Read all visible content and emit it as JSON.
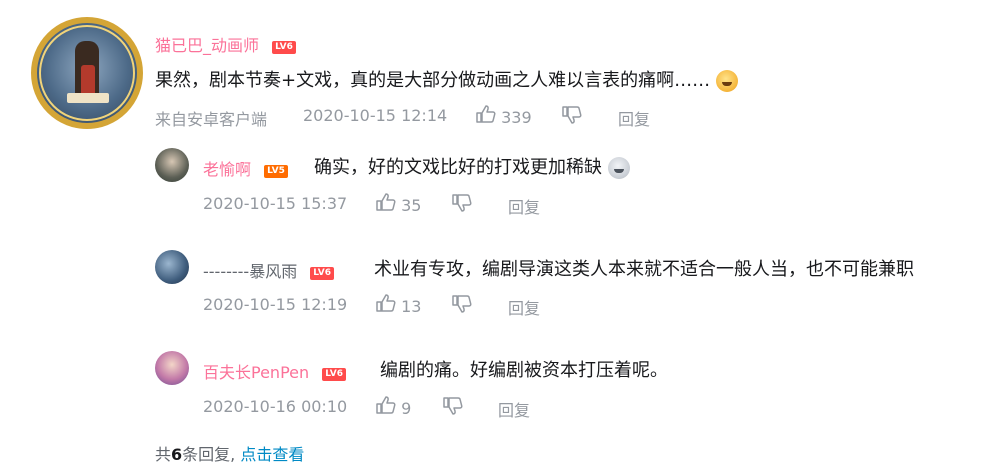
{
  "main_comment": {
    "username": "猫已巴_动画师",
    "level": "LV6",
    "content": "果然，剧本节奏+文戏，真的是大部分做动画之人难以言表的痛啊……",
    "source": "来自安卓客户端",
    "time": "2020-10-15 12:14",
    "likes": "339",
    "reply_label": "回复",
    "emoji": "crying-laugh-emoji"
  },
  "replies": [
    {
      "username": "老愉啊",
      "level": "LV5",
      "content": "确实，好的文戏比好的打戏更加稀缺",
      "time": "2020-10-15 15:37",
      "likes": "35",
      "reply_label": "回复",
      "emoji": "speechless-emoji"
    },
    {
      "username": "--------暴风雨",
      "level": "LV6",
      "content": "术业有专攻，编剧导演这类人本来就不适合一般人当，也不可能兼职",
      "time": "2020-10-15 12:19",
      "likes": "13",
      "reply_label": "回复"
    },
    {
      "username": "百夫长PenPen",
      "level": "LV6",
      "content": "编剧的痛。好编剧被资本打压着呢。",
      "time": "2020-10-16 00:10",
      "likes": "9",
      "reply_label": "回复"
    }
  ],
  "footer": {
    "prefix": "共",
    "count": "6",
    "suffix": "条回复,",
    "view_link": "点击查看"
  },
  "colors": {
    "username_pink": "#fb7299",
    "meta_grey": "#9499a0",
    "link_blue": "#008ac5",
    "level_orange": "#ff6c00",
    "level_red": "#ff4b4b"
  }
}
